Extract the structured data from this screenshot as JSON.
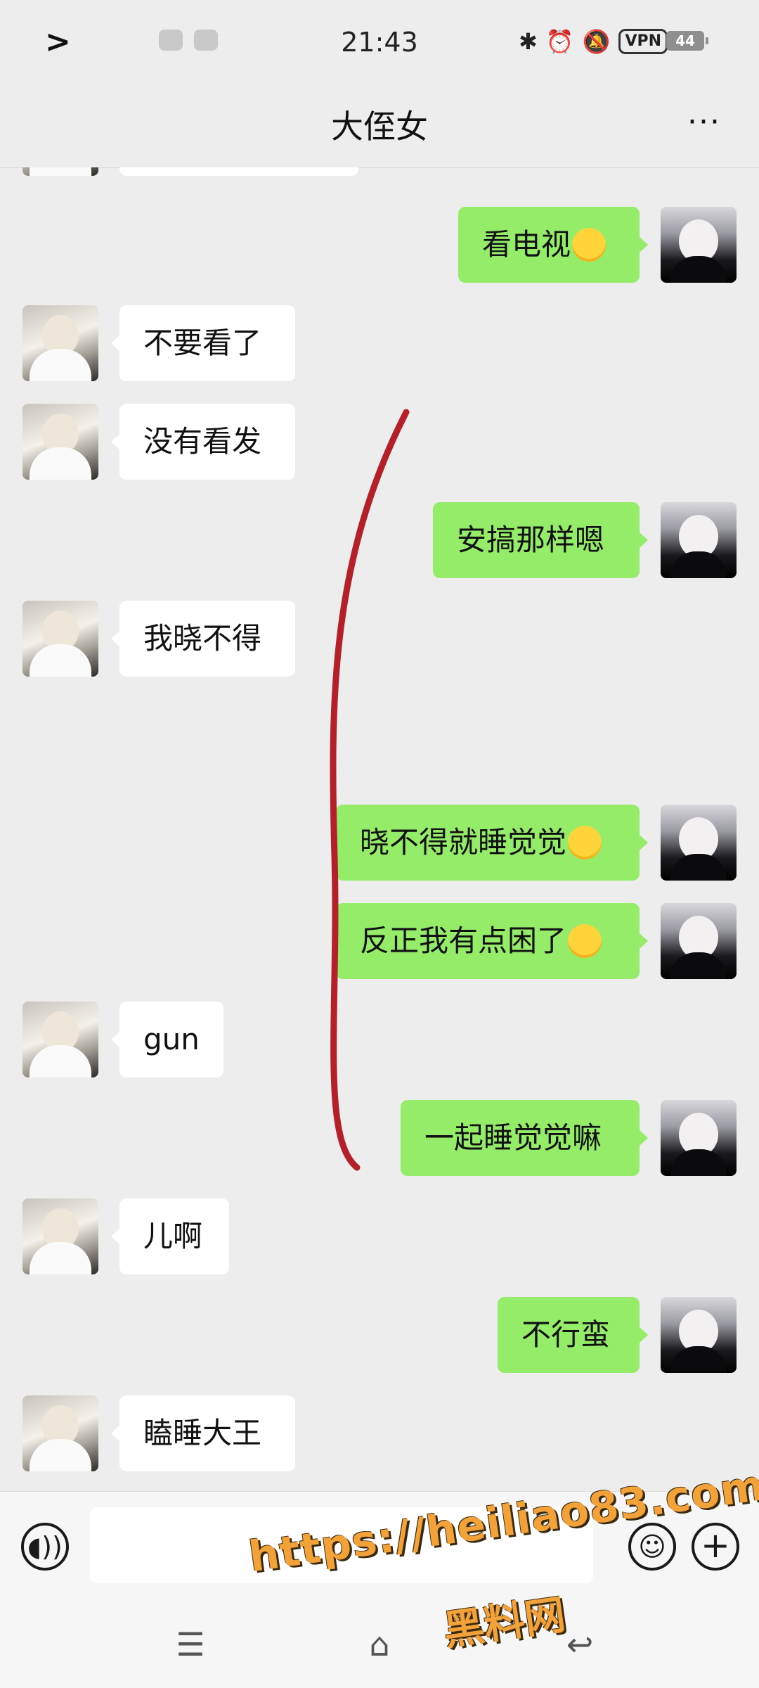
{
  "status_bar": {
    "time": "21:43",
    "left_glyph": ">",
    "vpn_label": "VPN",
    "battery": "44",
    "icons": [
      "chevron-right-icon",
      "wechat-icon",
      "notification-icon",
      "bluetooth-icon",
      "alarm-icon",
      "mute-icon",
      "vpn-icon",
      "battery-icon"
    ]
  },
  "header": {
    "title": "大侄女",
    "more_label": "···"
  },
  "messages": [
    {
      "side": "left",
      "text": "",
      "partial": true
    },
    {
      "side": "right",
      "text": "看电视",
      "emoji": "grin"
    },
    {
      "side": "left",
      "text": "不要看了"
    },
    {
      "side": "left",
      "text": "没有看发"
    },
    {
      "side": "right",
      "text": "安搞那样嗯"
    },
    {
      "side": "left",
      "text": "我晓不得"
    },
    {
      "side": "right",
      "text": "晓不得就睡觉觉",
      "emoji": "laugh"
    },
    {
      "side": "right",
      "text": "反正我有点困了",
      "emoji": "rofl"
    },
    {
      "side": "left",
      "text": "gun"
    },
    {
      "side": "right",
      "text": "一起睡觉觉嘛"
    },
    {
      "side": "left",
      "text": "儿啊"
    },
    {
      "side": "right",
      "text": "不行蛮"
    },
    {
      "side": "left",
      "text": "瞌睡大王"
    }
  ],
  "input_bar": {
    "voice_icon": "voice-icon",
    "emoji_icon": "emoji-icon",
    "plus_label": "+",
    "input_value": ""
  },
  "nav_bar": {
    "menu_glyph": "☰",
    "home_glyph": "⌂",
    "back_glyph": "↩"
  },
  "watermark": {
    "url": "https://heiliao83.com",
    "name": "黑料网"
  },
  "colors": {
    "background": "#ededed",
    "sent_bubble": "#95ec69",
    "received_bubble": "#ffffff",
    "annotation_line": "#b3202a",
    "watermark": "#f3a23a"
  }
}
